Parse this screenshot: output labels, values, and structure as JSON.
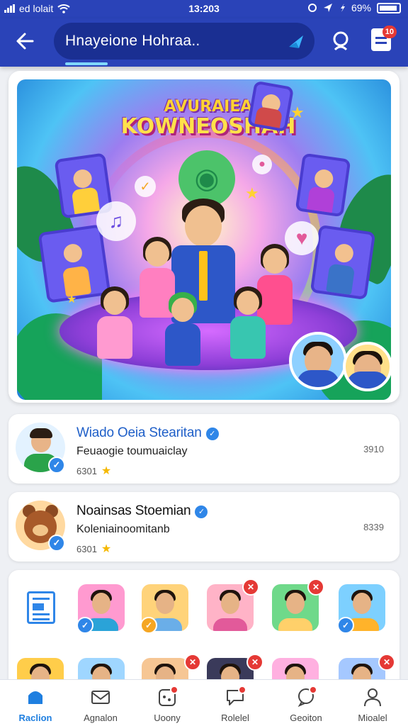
{
  "status_bar": {
    "carrier": "ed lolait",
    "time": "13:203",
    "battery": "69%"
  },
  "app_bar": {
    "search_query": "Hnayeione Hohraa..",
    "notification_badge": "10"
  },
  "hero": {
    "title_line1": "AVURAIEA",
    "title_line2": "KOWNEOSHAH"
  },
  "channels": [
    {
      "name": "Wiado Oeia Stearitan",
      "subtitle": "Feuaogie toumuaiclay",
      "count": "6301",
      "meta": "3910",
      "name_color": "#1f5fc8"
    },
    {
      "name": "Noainsas Stoemian",
      "subtitle": "Koleniainoomitanb",
      "count": "6301",
      "meta": "8339",
      "name_color": "#111111"
    }
  ],
  "grid": {
    "tiles_row1": [
      {
        "bg": "#ff9ad0",
        "shirt": "#2aa3d8",
        "badge_icon": "check",
        "badge_color": "#2f86e8",
        "badge_pos": "bl"
      },
      {
        "bg": "#ffd37a",
        "shirt": "#6aaee8",
        "badge_icon": "check",
        "badge_color": "#f5a623",
        "badge_pos": "bl"
      },
      {
        "bg": "#ffb3c7",
        "shirt": "#e25a9a",
        "badge_icon": "cross",
        "badge_color": "#e53935",
        "badge_pos": "tr"
      },
      {
        "bg": "#6fd98a",
        "shirt": "#ffd06a",
        "badge_icon": "cross",
        "badge_color": "#e53935",
        "badge_pos": "tr"
      },
      {
        "bg": "#7dd0ff",
        "shirt": "#ffb32a",
        "badge_icon": "check",
        "badge_color": "#2f86e8",
        "badge_pos": "bl"
      }
    ],
    "tiles_row2": [
      {
        "bg": "#ffcd4a",
        "shirt": "#3a73c8"
      },
      {
        "bg": "#9fd6ff",
        "shirt": "#d65a5a"
      },
      {
        "bg": "#f6c694",
        "shirt": "#e25a2a"
      },
      {
        "bg": "#3a3a5a",
        "shirt": "#b07bff"
      },
      {
        "bg": "#ffb0e0",
        "shirt": "#7a4ad8"
      },
      {
        "bg": "#a5c8ff",
        "shirt": "#4a7ad8"
      }
    ]
  },
  "bottom_nav": [
    {
      "label": "Raclion",
      "icon": "home-icon",
      "active": true,
      "dot": false
    },
    {
      "label": "Agnalon",
      "icon": "mail-icon",
      "active": false,
      "dot": false
    },
    {
      "label": "Uoony",
      "icon": "game-icon",
      "active": false,
      "dot": true
    },
    {
      "label": "Rolelel",
      "icon": "chat-icon",
      "active": false,
      "dot": true
    },
    {
      "label": "Geoiton",
      "icon": "comment-icon",
      "active": false,
      "dot": true
    },
    {
      "label": "Mioalel",
      "icon": "profile-icon",
      "active": false,
      "dot": false
    }
  ],
  "colors": {
    "brand": "#2a43b8",
    "accent": "#1f7fe0",
    "verified": "#2f86e8",
    "badge": "#e53935"
  }
}
